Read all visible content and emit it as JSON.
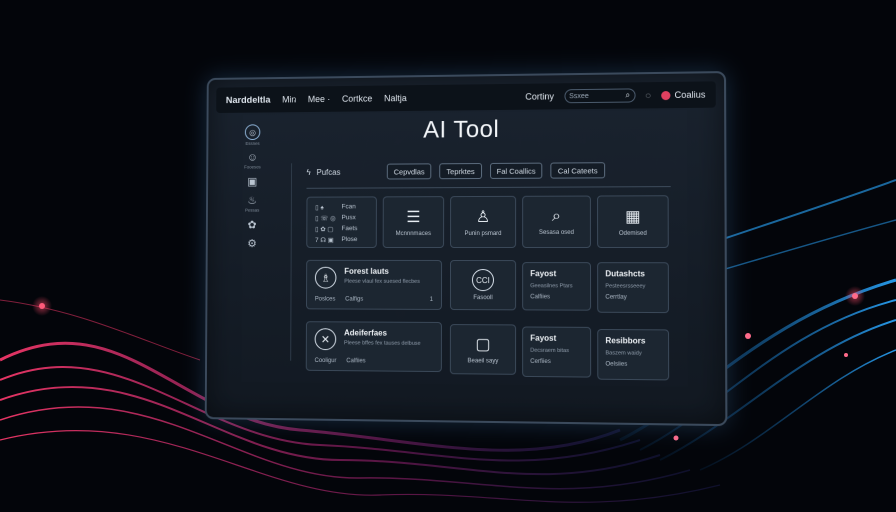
{
  "topbar": {
    "brand": "Narddeltla",
    "nav": [
      "Min",
      "Mee ·",
      "Cortkce",
      "Naltja"
    ],
    "status": "Cortiny",
    "search_placeholder": "Ssxee",
    "search_icon": "search-icon",
    "user_name": "Coalius"
  },
  "title": "AI Tool",
  "sidebar": [
    {
      "icon": "◎",
      "label": "Essnes",
      "active": true
    },
    {
      "icon": "☺",
      "label": "Fooesos"
    },
    {
      "icon": "▣",
      "label": ""
    },
    {
      "icon": "♨",
      "label": "Pessas"
    },
    {
      "icon": "✿",
      "label": ""
    },
    {
      "icon": "⚙",
      "label": ""
    }
  ],
  "filters": {
    "label": "Pufcas",
    "label_icon": "sparkle-icon",
    "chips": [
      "Cepvdlas",
      "Teprktes",
      "Fal Coallics",
      "Cal Cateets"
    ]
  },
  "apps": [
    "Fcan",
    "Pusx",
    "Faets",
    "Plose"
  ],
  "icon_cards": [
    {
      "icon": "☰",
      "label": "Mcnnnmaces"
    },
    {
      "icon": "♙",
      "label": "Punin psmard"
    },
    {
      "icon": "⌕",
      "label": "Sesasa osed"
    },
    {
      "icon": "▦",
      "label": "Odemised"
    }
  ],
  "wide_cards": [
    {
      "icon": "♗",
      "title": "Forest lauts",
      "subtitle": "Pleese vlaul fex suesed flecbes",
      "foot1": "Poslces",
      "foot2": "Calfigs",
      "end": "1"
    },
    {
      "icon": "✕",
      "title": "Adeiferfaes",
      "subtitle": "Pleese bffes fex tauses delbuse",
      "foot1": "Cooligur",
      "foot2": "Calfiies",
      "end": ""
    }
  ],
  "mid_cards": [
    {
      "icon": "CCI",
      "label": "Fasooll"
    },
    {
      "icon": "▢",
      "label": "Beaeil sayy"
    }
  ],
  "text_cards": [
    {
      "title": "Fayost",
      "subtitle": "Geeasilnes Ptars",
      "foot": "Calfiies"
    },
    {
      "title": "Dutashcts",
      "subtitle": "Pesteesrsseeey",
      "foot": "Cerrtlay"
    },
    {
      "title": "Fayost",
      "subtitle": "Decsraem bitas",
      "foot": "Cerfiies"
    },
    {
      "title": "Resibbors",
      "subtitle": "Baszem waidy",
      "foot": "Oelsiies"
    }
  ],
  "colors": {
    "accent": "#e04060",
    "panel": "#121922",
    "border": "#3b4a5c"
  }
}
